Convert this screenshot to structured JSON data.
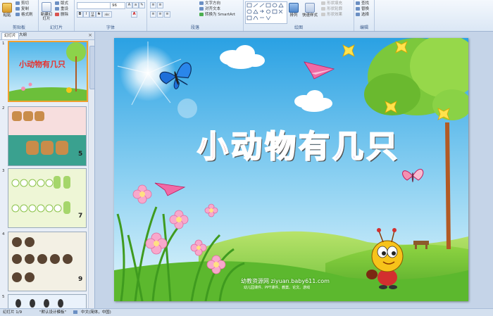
{
  "ribbon": {
    "groups": [
      "剪贴板",
      "幻灯片",
      "字体",
      "段落",
      "绘图",
      "编辑"
    ],
    "clipboard": {
      "paste": "粘贴",
      "cut": "剪切",
      "copy": "复制",
      "format_painter": "格式刷"
    },
    "slides": {
      "new_slide": "新建幻灯片",
      "layout": "版式",
      "reset": "重设",
      "delete": "删除"
    },
    "font": {
      "font_size": "96",
      "bold": "B",
      "italic": "I",
      "underline": "U",
      "strike": "S",
      "shadow": "abc",
      "font_color": "A"
    },
    "paragraph": {
      "text_direction": "文字方向",
      "align_text": "对齐文本",
      "smartart": "转换为 SmartArt"
    },
    "drawing": {
      "arrange": "排列",
      "quick_styles": "快速样式",
      "shape_fill": "形状填充",
      "shape_outline": "形状轮廓",
      "shape_effects": "形状效果"
    },
    "editing": {
      "find": "查找",
      "replace": "替换",
      "select": "选择"
    }
  },
  "panel": {
    "tabs": [
      "幻灯片",
      "大纲"
    ],
    "close": "×",
    "thumbnails": [
      {
        "num": "1",
        "page_label": "",
        "title": "小动物有几只"
      },
      {
        "num": "2",
        "page_label": "5"
      },
      {
        "num": "3",
        "page_label": "7"
      },
      {
        "num": "4",
        "page_label": "9"
      },
      {
        "num": "5",
        "page_label": ""
      }
    ]
  },
  "slide": {
    "title": "小动物有几只",
    "title_colors": [
      "#e8312c",
      "#f5a623",
      "#7ac143",
      "#2a6fdb",
      "#8b3fc4",
      "#2aa198"
    ],
    "watermark": "幼教资源网 ziyuan.baby611.com",
    "watermark_sub": "幼儿园课件、PPT课件、教案、论文、游戏"
  },
  "status": {
    "slide_info": "幻灯片 1/9",
    "theme": "\"默认设计模板\"",
    "language": "中文(简体，中国)"
  },
  "colors": {
    "ribbon_bg": "#dbe7f5",
    "panel_bg": "#e8eef7",
    "selected": "#f0a030"
  }
}
